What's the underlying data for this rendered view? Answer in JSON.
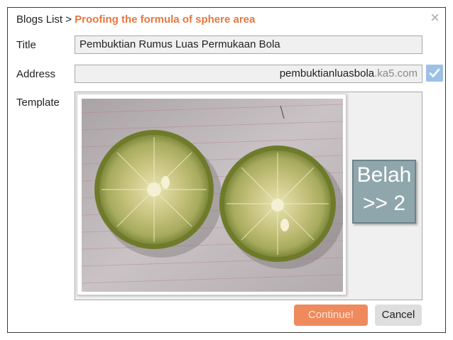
{
  "breadcrumb": {
    "root": "Blogs List",
    "separator": ">",
    "current": "Proofing the formula of sphere area"
  },
  "close_icon": "×",
  "labels": {
    "title": "Title",
    "address": "Address",
    "template": "Template"
  },
  "fields": {
    "title_value": "Pembuktian Rumus Luas Permukaan Bola",
    "address_subdomain": "pembuktianluasbola",
    "address_domain": ".ka5.com"
  },
  "template_image": {
    "icon": "photo-icon",
    "subject": "two halves of a lime on lined paper"
  },
  "belah_button": {
    "line1": "Belah",
    "line2": ">> 2"
  },
  "buttons": {
    "continue": "Continue!",
    "cancel": "Cancel"
  },
  "colors": {
    "breadcrumb_accent": "#e8763e",
    "continue_button": "#ef8a5c",
    "check_box": "#9dc0e6",
    "belah_button": "#8fa7ac"
  }
}
